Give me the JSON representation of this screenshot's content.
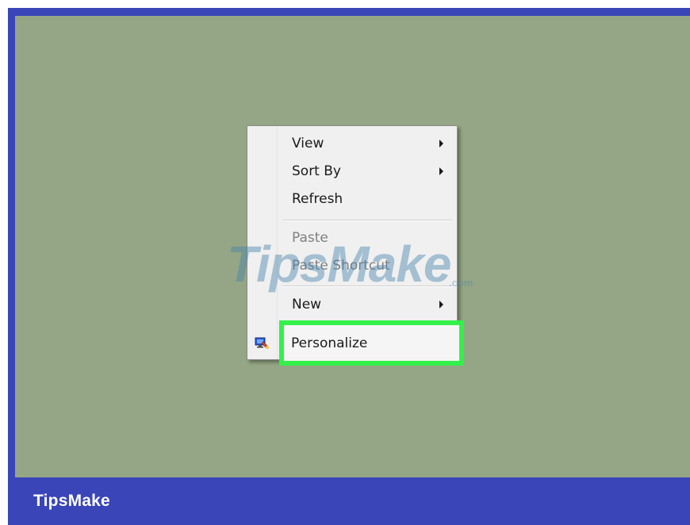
{
  "menu": {
    "items": [
      {
        "label": "View",
        "submenu": true,
        "enabled": true
      },
      {
        "label": "Sort By",
        "submenu": true,
        "enabled": true
      },
      {
        "label": "Refresh",
        "submenu": false,
        "enabled": true
      },
      {
        "label": "Paste",
        "submenu": false,
        "enabled": false
      },
      {
        "label": "Paste Shortcut",
        "submenu": false,
        "enabled": false
      },
      {
        "label": "New",
        "submenu": true,
        "enabled": true
      },
      {
        "label": "Personalize",
        "submenu": false,
        "enabled": true,
        "highlighted": true,
        "icon": "personalize-icon"
      }
    ]
  },
  "watermark": {
    "text": "TipsMake",
    "suffix": ".com"
  },
  "footer": {
    "brand": "TipsMake"
  },
  "colors": {
    "frame_blue": "#3a45b8",
    "desktop_green": "#94a685",
    "highlight_green": "#33f04a",
    "menu_bg": "#f0f0f0"
  }
}
